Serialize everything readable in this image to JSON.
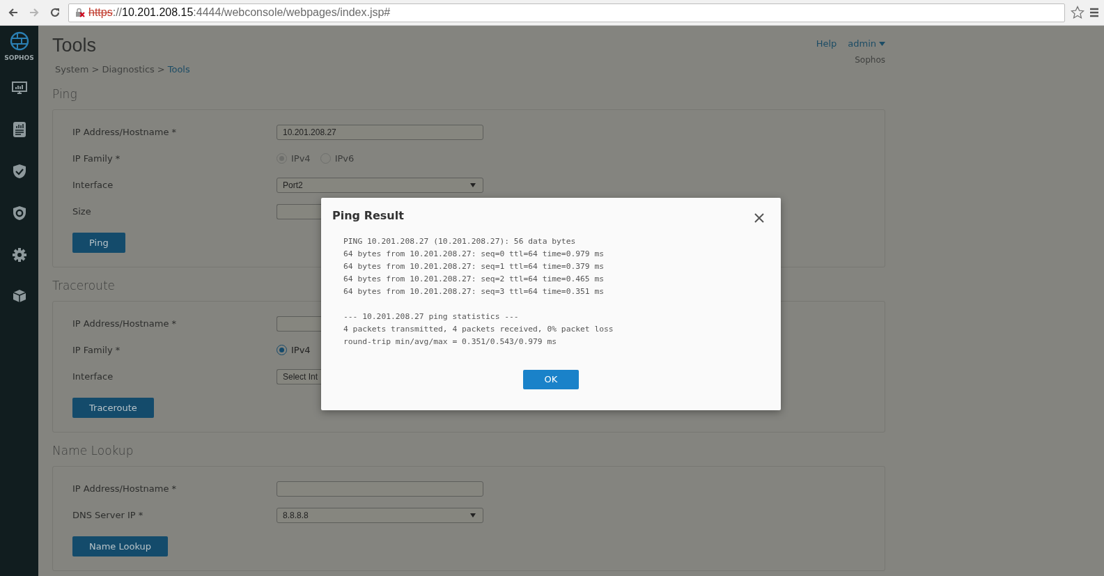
{
  "browser": {
    "forward_disabled": true,
    "url_parts": [
      {
        "kind": "insecure",
        "text": "https"
      },
      {
        "kind": "plain",
        "text": "://"
      },
      {
        "kind": "host",
        "text": "10.201.208.15"
      },
      {
        "kind": "plain",
        "text": ":4444/webconsole/webpages/index.jsp#"
      }
    ]
  },
  "sidebar": {
    "brand": "SOPHOS"
  },
  "header": {
    "title": "Tools",
    "separator": ">",
    "breadcrumb": [
      {
        "text": "System",
        "current": false
      },
      {
        "text": "Diagnostics",
        "current": false
      },
      {
        "text": "Tools",
        "current": true
      }
    ],
    "help": "Help",
    "user": "admin",
    "company": "Sophos"
  },
  "sections": [
    {
      "title": "Ping",
      "button": "Ping",
      "fields": [
        {
          "kind": "text",
          "label": "IP Address/Hostname *",
          "value": "10.201.208.27"
        },
        {
          "kind": "radio",
          "label": "IP Family *",
          "options": [
            {
              "label": "IPv4",
              "selected": true,
              "disabled": true
            },
            {
              "label": "IPv6",
              "selected": false,
              "disabled": true
            }
          ]
        },
        {
          "kind": "select",
          "label": "Interface",
          "value": "Port2"
        },
        {
          "kind": "text",
          "label": "Size"
        }
      ]
    },
    {
      "title": "Traceroute",
      "button": "Traceroute",
      "fields": [
        {
          "kind": "text",
          "label": "IP Address/Hostname *"
        },
        {
          "kind": "radio",
          "label": "IP Family *",
          "options": [
            {
              "label": "IPv4",
              "selected": true,
              "disabled": false
            }
          ]
        },
        {
          "kind": "select",
          "label": "Interface",
          "value": "Select Int"
        }
      ]
    },
    {
      "title": "Name Lookup",
      "button": "Name Lookup",
      "fields": [
        {
          "kind": "text",
          "label": "IP Address/Hostname *"
        },
        {
          "kind": "select",
          "label": "DNS Server IP *",
          "value": "8.8.8.8"
        }
      ]
    }
  ],
  "dialog": {
    "title": "Ping Result",
    "ok": "OK",
    "paragraphs": [
      [
        "PING 10.201.208.27 (10.201.208.27): 56 data bytes",
        "64 bytes from 10.201.208.27: seq=0 ttl=64 time=0.979 ms",
        "64 bytes from 10.201.208.27: seq=1 ttl=64 time=0.379 ms",
        "64 bytes from 10.201.208.27: seq=2 ttl=64 time=0.465 ms",
        "64 bytes from 10.201.208.27: seq=3 ttl=64 time=0.351 ms"
      ],
      [
        "--- 10.201.208.27 ping statistics ---",
        "4 packets transmitted, 4 packets received, 0% packet loss",
        "round-trip min/avg/max = 0.351/0.543/0.979 ms"
      ]
    ]
  }
}
